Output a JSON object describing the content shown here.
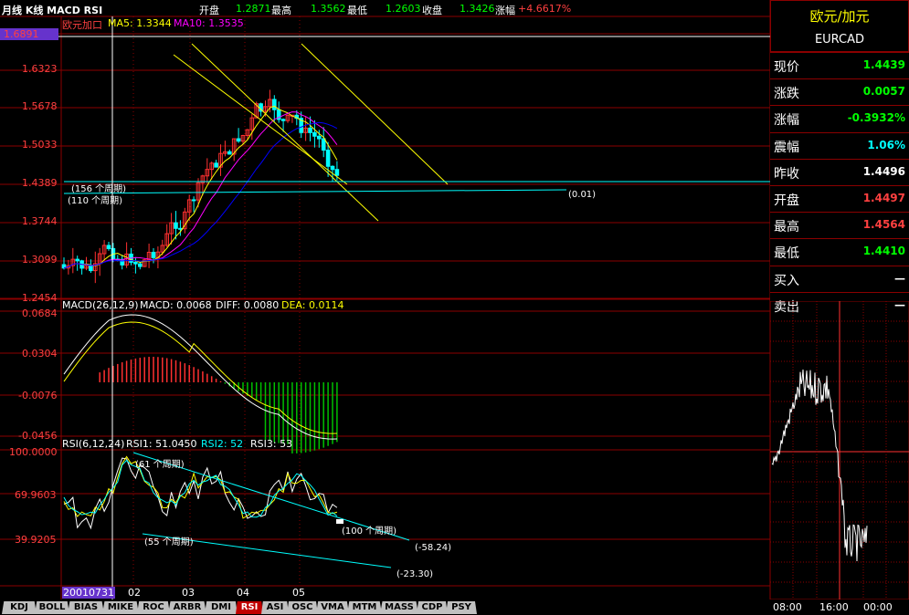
{
  "topbar": {
    "title": "月线 K线 MACD RSI",
    "open_label": "开盘",
    "open_val": "1.2871",
    "high_label": "最高",
    "high_val": "1.3562",
    "low_label": "最低",
    "low_val": "1.2603",
    "close_label": "收盘",
    "close_val": "1.3426",
    "change_label": "涨幅",
    "change_val": "+4.6617%"
  },
  "kline": {
    "name": "欧元加口",
    "ma5": "MA5: 1.3344",
    "ma10": "MA10: 1.3535",
    "yticks": [
      "1.6891",
      "1.6323",
      "1.5678",
      "1.5033",
      "1.4389",
      "1.3744",
      "1.3099",
      "1.2454"
    ],
    "ann_156": "(156 个周期)",
    "ann_110": "(110 个周期)",
    "ann_001": "(0.01)"
  },
  "macd": {
    "title": "MACD(26,12,9)",
    "macd": "MACD: 0.0068",
    "diff": "DIFF: 0.0080",
    "dea": "DEA: 0.0114",
    "yticks": [
      "0.0684",
      "0.0304",
      "-0.0076",
      "-0.0456"
    ]
  },
  "rsi": {
    "title": "RSI(6,12,24)",
    "rsi1": "RSI1: 51.0450",
    "rsi2": "RSI2: 52",
    "rsi3": "RSI3: 53",
    "yticks": [
      "100.0000",
      "69.9603",
      "39.9205"
    ],
    "ann_61": "(61 个周期)",
    "ann_55": "(55 个周期)",
    "ann_100": "(100 个周期)",
    "ann_m5824": "(-58.24)",
    "ann_m2330": "(-23.30)"
  },
  "xaxis": {
    "date": "20010731",
    "labels": [
      "02",
      "03",
      "04",
      "05"
    ]
  },
  "quote": {
    "name": "欧元/加元",
    "code": "EURCAD",
    "rows": [
      {
        "k": "现价",
        "v": "1.4439",
        "c": "#00ff00"
      },
      {
        "k": "涨跌",
        "v": "0.0057",
        "c": "#00ff00"
      },
      {
        "k": "涨幅",
        "v": "-0.3932%",
        "c": "#00ff00"
      },
      {
        "k": "震幅",
        "v": "1.06%",
        "c": "#00ffff"
      },
      {
        "k": "昨收",
        "v": "1.4496",
        "c": "#ffffff"
      },
      {
        "k": "开盘",
        "v": "1.4497",
        "c": "#ff4040"
      },
      {
        "k": "最高",
        "v": "1.4564",
        "c": "#ff4040"
      },
      {
        "k": "最低",
        "v": "1.4410",
        "c": "#00ff00"
      },
      {
        "k": "买入",
        "v": "—",
        "c": "#ffffff"
      },
      {
        "k": "卖出",
        "v": "—",
        "c": "#ffffff"
      }
    ]
  },
  "intraday": {
    "times": [
      "08:00",
      "16:00",
      "00:00"
    ]
  },
  "tabs": [
    "KDJ",
    "BOLL",
    "BIAS",
    "MIKE",
    "ROC",
    "ARBR",
    "DMI",
    "RSI",
    "ASI",
    "OSC",
    "VMA",
    "MTM",
    "MASS",
    "CDP",
    "PSY"
  ],
  "active_tab": "RSI",
  "colors": {
    "up": "#ff3030",
    "down": "#00ffff",
    "grid": "#8b0000",
    "ma5": "#ffff00",
    "ma10": "#ff00ff",
    "ma20": "#0000ff",
    "ma30": "#00ff00",
    "macd_neg": "#00c000",
    "rsi1": "#ffffff",
    "rsi2": "#ffff00",
    "rsi3": "#ff00ff"
  }
}
